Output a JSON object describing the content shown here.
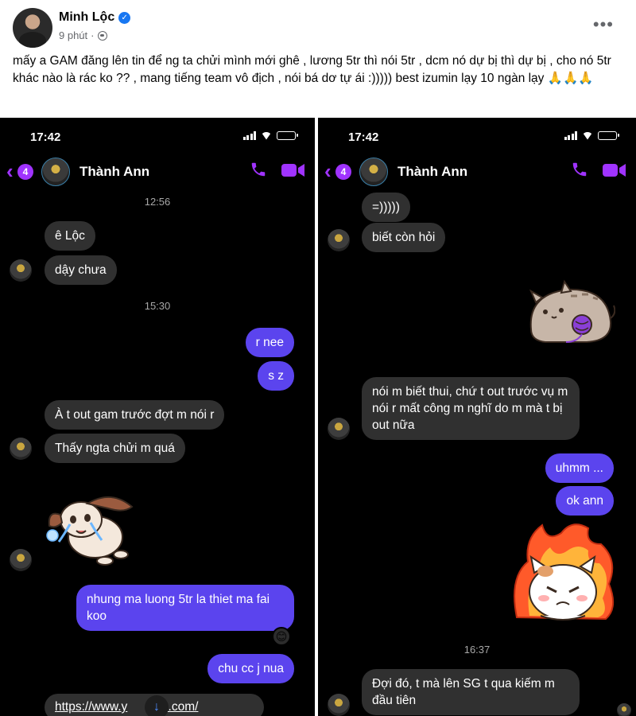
{
  "post": {
    "author": "Minh Lộc",
    "time": "9 phút",
    "caption": "mấy a GAM đăng lên tin để ng ta chửi mình mới ghê , lương 5tr thì nói 5tr , dcm nó dự bị thì dự bị , cho nó 5tr khác nào là rác ko ?? , mang tiếng team vô địch , nói bá dơ tự ái :))))) best izumin lạy 10 ngàn lạy 🙏🙏🙏"
  },
  "left_screen": {
    "status_time": "17:42",
    "unread_count": "4",
    "contact_name": "Thành Ann",
    "timestamp_1": "12:56",
    "msg_1": "ê Lộc",
    "msg_2": "dậy chưa",
    "timestamp_2": "15:30",
    "msg_3": "r nee",
    "msg_4": "s z",
    "msg_5": "À t out gam trước đợt m nói r",
    "msg_6": "Thấy ngta chửi m quá",
    "msg_7": "nhung ma luong 5tr la thiet ma fai koo",
    "reaction": "😊",
    "msg_8": "chu cc j nua",
    "msg_9": "https://www.y",
    "msg_9b": "be.com/"
  },
  "right_screen": {
    "status_time": "17:42",
    "unread_count": "4",
    "contact_name": "Thành Ann",
    "msg_1": "=)))))",
    "msg_2": "biết còn hỏi",
    "msg_3": "nói m biết thui, chứ t out trước vụ m nói r mất công m nghĩ do m mà t bị out nữa",
    "msg_4": "uhmm ...",
    "msg_5": "ok ann",
    "timestamp_1": "16:37",
    "msg_6": "Đợi đó, t mà lên SG t qua kiếm m đầu tiên"
  },
  "colors": {
    "accent": "#a033ff",
    "outgoing_bubble": "#5b44ee",
    "incoming_bubble": "#303030",
    "verified": "#1877f2"
  }
}
